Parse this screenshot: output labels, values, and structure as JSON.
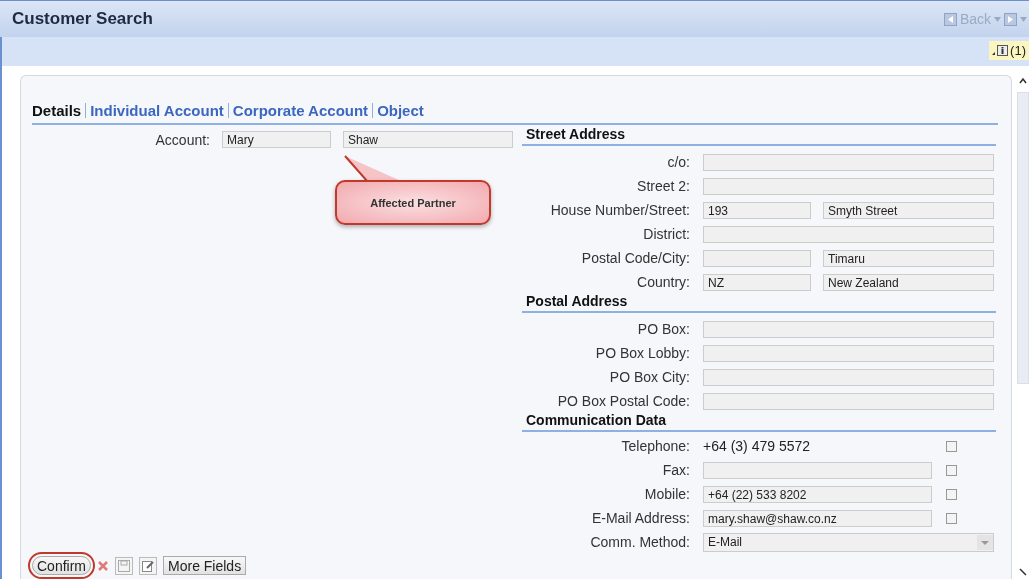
{
  "window": {
    "title": "Customer Search"
  },
  "nav": {
    "back": "Back"
  },
  "messages": {
    "count": "(1)"
  },
  "tabs": [
    {
      "label": "Details",
      "selected": true
    },
    {
      "label": "Individual Account",
      "selected": false
    },
    {
      "label": "Corporate Account",
      "selected": false
    },
    {
      "label": "Object",
      "selected": false
    }
  ],
  "account": {
    "label": "Account:",
    "first_name": "Mary",
    "last_name": "Shaw"
  },
  "callout": {
    "text": "Affected Partner"
  },
  "sections": [
    {
      "title": "Street Address",
      "rows": [
        {
          "kind": "single",
          "label": "c/o:"
        },
        {
          "kind": "single",
          "label": "Street 2:"
        },
        {
          "kind": "pair",
          "label": "House Number/Street:",
          "first": "193",
          "second": "Smyth Street"
        },
        {
          "kind": "single",
          "label": "District:"
        },
        {
          "kind": "pair",
          "label": "Postal Code/City:",
          "second": "Timaru"
        },
        {
          "kind": "pair",
          "label": "Country:",
          "first": "NZ",
          "second": "New Zealand"
        }
      ]
    },
    {
      "title": "Postal Address",
      "rows": [
        {
          "kind": "single",
          "label": "PO Box:"
        },
        {
          "kind": "single",
          "label": "PO Box Lobby:"
        },
        {
          "kind": "single",
          "label": "PO Box City:"
        },
        {
          "kind": "single",
          "label": "PO Box Postal Code:"
        }
      ]
    },
    {
      "title": "Communication Data",
      "rows": [
        {
          "kind": "text-check",
          "label": "Telephone:",
          "value": "+64 (3) 479 5572",
          "checked": false
        },
        {
          "kind": "field-check",
          "label": "Fax:",
          "checked": false
        },
        {
          "kind": "field-check",
          "label": "Mobile:",
          "value": "+64 (22) 533 8202",
          "checked": false
        },
        {
          "kind": "field-check",
          "label": "E-Mail Address:",
          "value": "mary.shaw@shaw.co.nz",
          "checked": false
        },
        {
          "kind": "select",
          "label": "Comm. Method:",
          "value": "E-Mail"
        }
      ]
    }
  ],
  "buttons": [
    {
      "kind": "text",
      "label": "Confirm",
      "highlighted": true
    },
    {
      "kind": "delete-icon"
    },
    {
      "kind": "save-icon"
    },
    {
      "kind": "edit-icon"
    },
    {
      "kind": "text",
      "label": "More Fields",
      "highlighted": false
    }
  ]
}
